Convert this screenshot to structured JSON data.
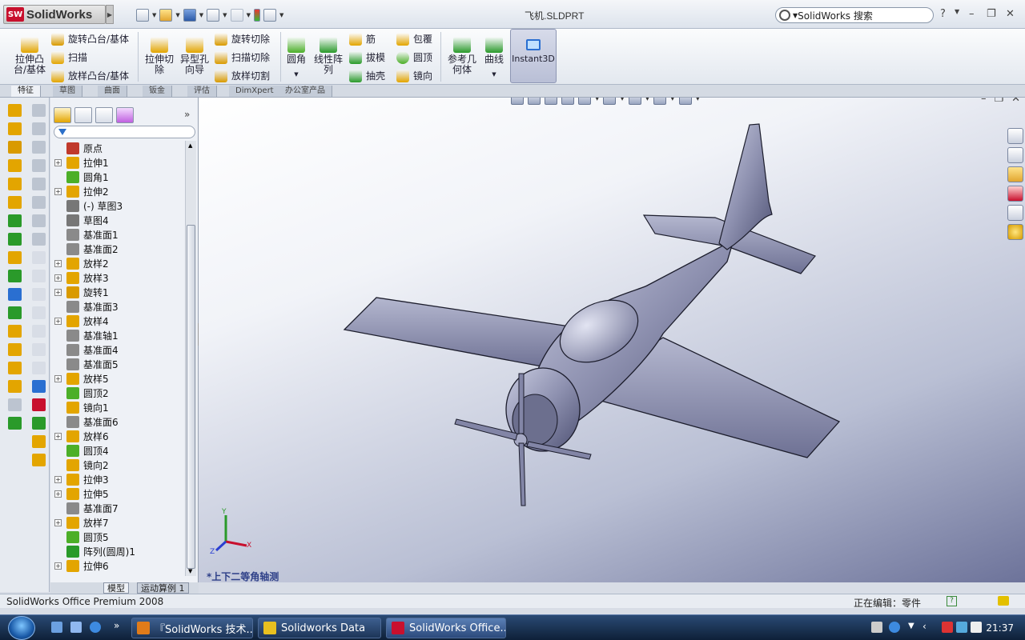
{
  "titlebar": {
    "brand": "SolidWorks",
    "badge": "SW",
    "document_title": "飞机.SLDPRT",
    "search_placeholder": "SolidWorks 搜索",
    "help": "?"
  },
  "ribbon": {
    "items": [
      {
        "id": "extrude",
        "label1": "拉伸凸",
        "label2": "台/基体",
        "color": "#e3a500"
      },
      {
        "id": "revolve-boss",
        "label": "旋转凸台/基体",
        "color": "#d99a00"
      },
      {
        "id": "sweep",
        "label": "扫描",
        "color": "#e3a500"
      },
      {
        "id": "loft",
        "label": "放样凸台/基体",
        "color": "#e3a500"
      },
      {
        "id": "extrude-cut",
        "label1": "拉伸切",
        "label2": "除",
        "color": "#e3a500"
      },
      {
        "id": "hole-wizard",
        "label1": "异型孔",
        "label2": "向导",
        "color": "#e3a500"
      },
      {
        "id": "revolve-cut",
        "label": "旋转切除",
        "color": "#d99a00"
      },
      {
        "id": "sweep-cut",
        "label": "扫描切除",
        "color": "#d99a00"
      },
      {
        "id": "loft-cut",
        "label": "放样切割",
        "color": "#d99a00"
      },
      {
        "id": "fillet",
        "label": "圆角",
        "color": "#4caf28"
      },
      {
        "id": "linear-pattern",
        "label1": "线性阵",
        "label2": "列",
        "color": "#2a9a2a"
      },
      {
        "id": "rib",
        "label": "筋",
        "color": "#e3a500"
      },
      {
        "id": "draft",
        "label": "拔模",
        "color": "#2a9a2a"
      },
      {
        "id": "shell",
        "label": "抽壳",
        "color": "#2a9a2a"
      },
      {
        "id": "wrap",
        "label": "包覆",
        "color": "#e3a500"
      },
      {
        "id": "dome",
        "label": "圆顶",
        "color": "#4caf28"
      },
      {
        "id": "mirror",
        "label": "镜向",
        "color": "#e3a500"
      },
      {
        "id": "ref-geom",
        "label1": "参考几",
        "label2": "何体",
        "color": "#2a9a2a"
      },
      {
        "id": "curves",
        "label": "曲线",
        "color": "#2a9a2a"
      }
    ],
    "instant3d": "Instant3D"
  },
  "tabs": [
    "特征",
    "草图",
    "曲面",
    "钣金",
    "评估",
    "DimXpert",
    "办公室产品"
  ],
  "tree": {
    "items": [
      {
        "label": "原点",
        "expand": false,
        "color": "#c0392b"
      },
      {
        "label": "拉伸1",
        "expand": true,
        "color": "#e3a500"
      },
      {
        "label": "圆角1",
        "expand": false,
        "color": "#4caf28"
      },
      {
        "label": "拉伸2",
        "expand": true,
        "color": "#e3a500"
      },
      {
        "label": "(-) 草图3",
        "expand": false,
        "color": "#777777"
      },
      {
        "label": "草图4",
        "expand": false,
        "color": "#777777"
      },
      {
        "label": "基准面1",
        "expand": false,
        "color": "#8a8a8a"
      },
      {
        "label": "基准面2",
        "expand": false,
        "color": "#8a8a8a"
      },
      {
        "label": "放样2",
        "expand": true,
        "color": "#e3a500"
      },
      {
        "label": "放样3",
        "expand": true,
        "color": "#e3a500"
      },
      {
        "label": "旋转1",
        "expand": true,
        "color": "#d99a00"
      },
      {
        "label": "基准面3",
        "expand": false,
        "color": "#8a8a8a"
      },
      {
        "label": "放样4",
        "expand": true,
        "color": "#e3a500"
      },
      {
        "label": "基准轴1",
        "expand": false,
        "color": "#8a8a8a"
      },
      {
        "label": "基准面4",
        "expand": false,
        "color": "#8a8a8a"
      },
      {
        "label": "基准面5",
        "expand": false,
        "color": "#8a8a8a"
      },
      {
        "label": "放样5",
        "expand": true,
        "color": "#e3a500"
      },
      {
        "label": "圆顶2",
        "expand": false,
        "color": "#4caf28"
      },
      {
        "label": "镜向1",
        "expand": false,
        "color": "#e3a500"
      },
      {
        "label": "基准面6",
        "expand": false,
        "color": "#8a8a8a"
      },
      {
        "label": "放样6",
        "expand": true,
        "color": "#e3a500"
      },
      {
        "label": "圆顶4",
        "expand": false,
        "color": "#4caf28"
      },
      {
        "label": "镜向2",
        "expand": false,
        "color": "#e3a500"
      },
      {
        "label": "拉伸3",
        "expand": true,
        "color": "#e3a500"
      },
      {
        "label": "拉伸5",
        "expand": true,
        "color": "#e3a500"
      },
      {
        "label": "基准面7",
        "expand": false,
        "color": "#8a8a8a"
      },
      {
        "label": "放样7",
        "expand": true,
        "color": "#e3a500"
      },
      {
        "label": "圆顶5",
        "expand": false,
        "color": "#4caf28"
      },
      {
        "label": "阵列(圆周)1",
        "expand": false,
        "color": "#2a9a2a"
      },
      {
        "label": "拉伸6",
        "expand": true,
        "color": "#e3a500"
      }
    ],
    "bottom_tabs": [
      "模型",
      "运动算例 1"
    ]
  },
  "viewport": {
    "view_label": "*上下二等角轴测",
    "axis_x": "X",
    "axis_y": "Y",
    "axis_z": "Z"
  },
  "status": {
    "product": "SolidWorks Office Premium 2008",
    "editing": "正在编辑：零件"
  },
  "taskbar": {
    "buttons": [
      {
        "label": "『SolidWorks 技术...",
        "color": "#e07b1a",
        "active": false
      },
      {
        "label": "Solidworks Data",
        "color": "#e8c020",
        "active": false
      },
      {
        "label": "SolidWorks Office...",
        "color": "#c8102e",
        "active": true
      }
    ],
    "clock": "21:37"
  }
}
